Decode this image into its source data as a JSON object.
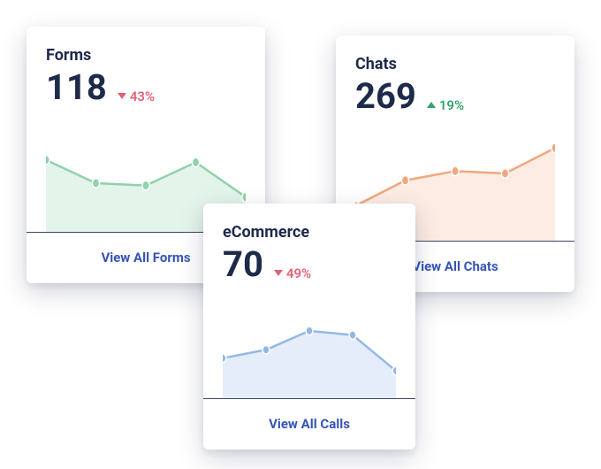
{
  "cards": {
    "forms": {
      "title": "Forms",
      "value": "118",
      "delta_dir": "down",
      "delta_text": "43%",
      "footer": "View All Forms"
    },
    "chats": {
      "title": "Chats",
      "value": "269",
      "delta_dir": "up",
      "delta_text": "19%",
      "footer": "View All Chats"
    },
    "ecommerce": {
      "title": "eCommerce",
      "value": "70",
      "delta_dir": "down",
      "delta_text": "49%",
      "footer": "View All Calls"
    }
  },
  "colors": {
    "forms_line": "#8fd2ab",
    "forms_fill": "rgba(143,210,171,0.25)",
    "chats_line": "#f0a77e",
    "chats_fill": "rgba(240,167,126,0.22)",
    "ecom_line": "#93b8e6",
    "ecom_fill": "rgba(147,184,230,0.25)"
  },
  "chart_data": [
    {
      "id": "forms",
      "type": "line",
      "title": "Forms",
      "x": [
        0,
        1,
        2,
        3,
        4
      ],
      "values": [
        62,
        42,
        40,
        60,
        30
      ],
      "ylim": [
        0,
        100
      ]
    },
    {
      "id": "chats",
      "type": "line",
      "title": "Chats",
      "x": [
        0,
        1,
        2,
        3,
        4
      ],
      "values": [
        30,
        52,
        60,
        58,
        80
      ],
      "ylim": [
        0,
        100
      ]
    },
    {
      "id": "ecommerce",
      "type": "line",
      "title": "eCommerce",
      "x": [
        0,
        1,
        2,
        3,
        4
      ],
      "values": [
        38,
        46,
        64,
        60,
        26
      ],
      "ylim": [
        0,
        100
      ]
    }
  ]
}
